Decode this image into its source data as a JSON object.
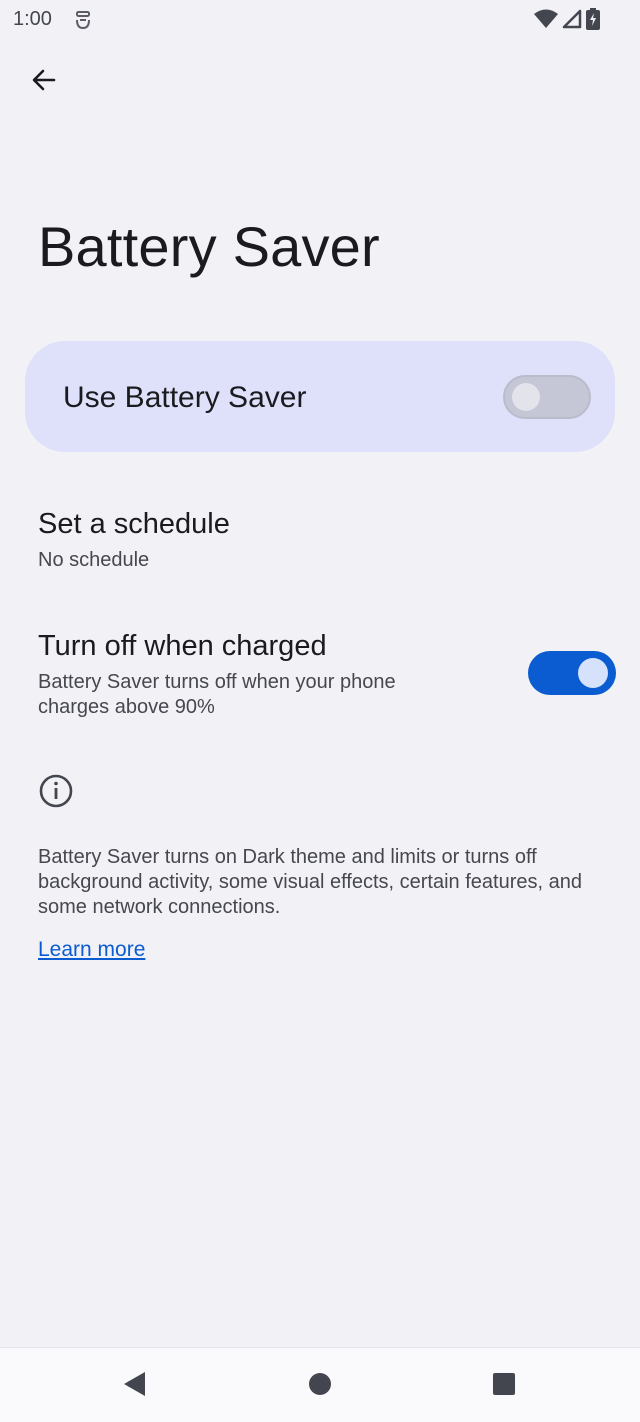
{
  "status_bar": {
    "time": "1:00",
    "icons": [
      "notification-icon",
      "wifi-icon",
      "cell-signal-icon",
      "battery-charging-icon"
    ]
  },
  "header": {
    "back_icon": "back-arrow-icon",
    "title": "Battery Saver"
  },
  "main_switch": {
    "label": "Use Battery Saver",
    "checked": false
  },
  "items": [
    {
      "title": "Set a schedule",
      "summary": "No schedule"
    },
    {
      "title": "Turn off when charged",
      "summary": "Battery Saver turns off when your phone charges above 90%",
      "checked": true
    }
  ],
  "footer": {
    "icon": "info-icon",
    "text": "Battery Saver turns on Dark theme and limits or turns off background activity, some visual effects, certain features, and some network connections.",
    "link": "Learn more"
  },
  "nav_bar": {
    "buttons": [
      "nav-back-icon",
      "nav-home-icon",
      "nav-recents-icon"
    ]
  },
  "colors": {
    "background": "#f2f2f6",
    "card": "#dfe0fa",
    "accent": "#0b5cd1",
    "text_primary": "#1b1b1f",
    "text_secondary": "#46474f"
  }
}
